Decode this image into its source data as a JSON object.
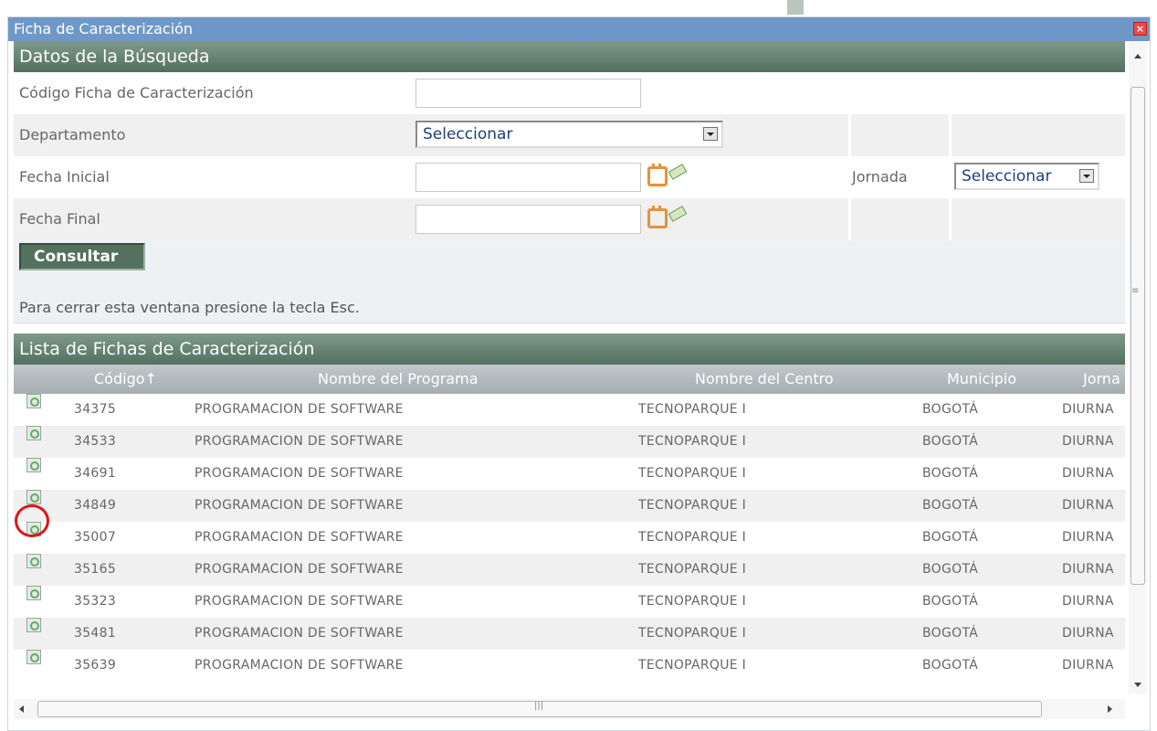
{
  "window": {
    "title": "Ficha de Caracterización",
    "close_icon": "close-icon"
  },
  "search": {
    "header": "Datos de la Búsqueda",
    "codigo_label": "Código Ficha de Caracterización",
    "codigo_value": "",
    "departamento_label": "Departamento",
    "departamento_value": "Seleccionar",
    "fecha_inicial_label": "Fecha Inicial",
    "fecha_inicial_value": "",
    "fecha_final_label": "Fecha Final",
    "fecha_final_value": "",
    "jornada_label": "Jornada",
    "jornada_value": "Seleccionar",
    "consultar_label": "Consultar",
    "hint": "Para cerrar esta ventana presione la tecla Esc."
  },
  "list": {
    "header": "Lista de Fichas de Caracterización",
    "columns": [
      "Código↑",
      "Nombre del Programa",
      "Nombre del Centro",
      "Municipio",
      "Jorna"
    ],
    "rows": [
      [
        "34375",
        "PROGRAMACION DE SOFTWARE",
        "TECNOPARQUE I",
        "BOGOTÁ",
        "DIURNA"
      ],
      [
        "34533",
        "PROGRAMACION DE SOFTWARE",
        "TECNOPARQUE I",
        "BOGOTÁ",
        "DIURNA"
      ],
      [
        "34691",
        "PROGRAMACION DE SOFTWARE",
        "TECNOPARQUE I",
        "BOGOTÁ",
        "DIURNA"
      ],
      [
        "34849",
        "PROGRAMACION DE SOFTWARE",
        "TECNOPARQUE I",
        "BOGOTÁ",
        "DIURNA"
      ],
      [
        "35007",
        "PROGRAMACION DE SOFTWARE",
        "TECNOPARQUE I",
        "BOGOTÁ",
        "DIURNA"
      ],
      [
        "35165",
        "PROGRAMACION DE SOFTWARE",
        "TECNOPARQUE I",
        "BOGOTÁ",
        "DIURNA"
      ],
      [
        "35323",
        "PROGRAMACION DE SOFTWARE",
        "TECNOPARQUE I",
        "BOGOTÁ",
        "DIURNA"
      ],
      [
        "35481",
        "PROGRAMACION DE SOFTWARE",
        "TECNOPARQUE I",
        "BOGOTÁ",
        "DIURNA"
      ],
      [
        "35639",
        "PROGRAMACION DE SOFTWARE",
        "TECNOPARQUE I",
        "BOGOTÁ",
        "DIURNA"
      ]
    ]
  },
  "colors": {
    "title_bar": "#6f98c8",
    "section_header": "#5f7d6c",
    "highlight": "#e01515"
  }
}
